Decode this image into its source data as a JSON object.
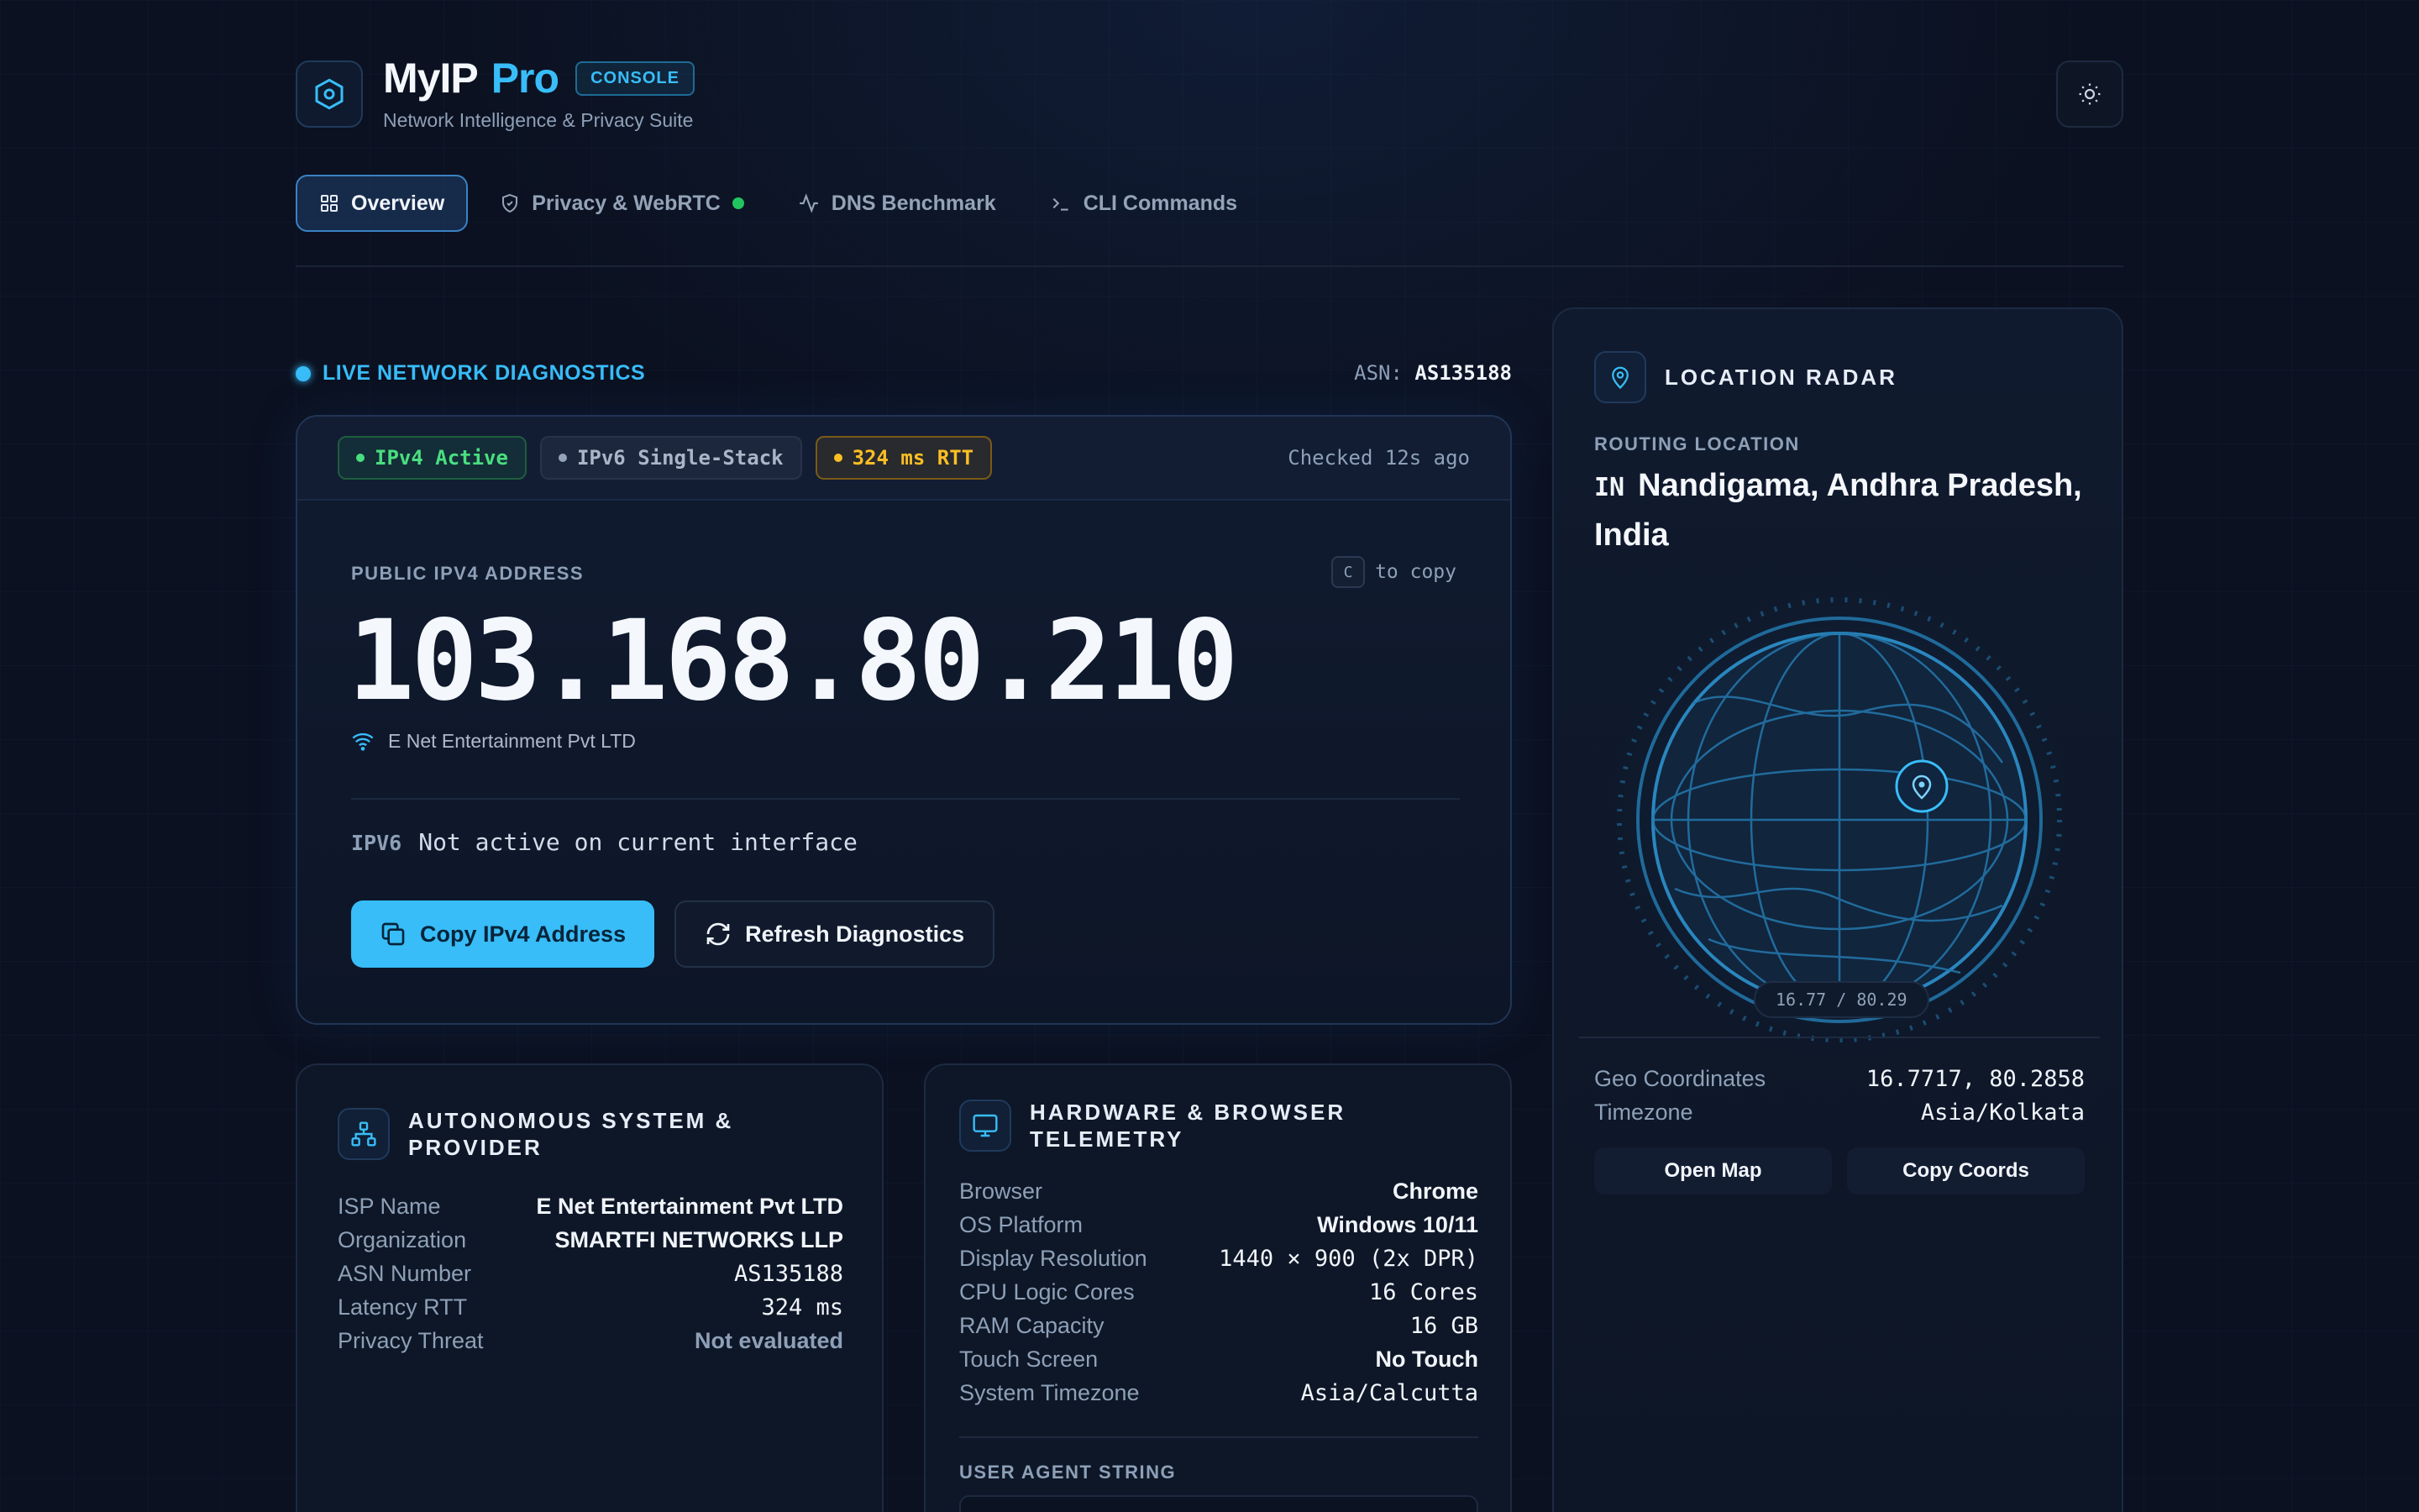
{
  "header": {
    "brand_name": "MyIP",
    "brand_pro": "Pro",
    "badge": "CONSOLE",
    "tagline": "Network Intelligence & Privacy Suite"
  },
  "tabs": [
    {
      "label": "Overview",
      "icon": "grid-icon",
      "active": true
    },
    {
      "label": "Privacy & WebRTC",
      "icon": "shield-icon",
      "status_dot": true
    },
    {
      "label": "DNS Benchmark",
      "icon": "activity-icon"
    },
    {
      "label": "CLI Commands",
      "icon": "terminal-icon"
    }
  ],
  "diagnostics": {
    "live_label": "LIVE NETWORK DIAGNOSTICS",
    "asn_label": "ASN:",
    "asn_value": "AS135188"
  },
  "ip_card": {
    "pills": {
      "ipv4": "IPv4 Active",
      "ipv6": "IPv6 Single-Stack",
      "rtt": "324 ms RTT"
    },
    "checked": "Checked 12s ago",
    "address_label": "PUBLIC IPV4 ADDRESS",
    "copy_key": "C",
    "copy_hint": "to copy",
    "ip": "103.168.80.210",
    "isp": "E Net Entertainment Pvt LTD",
    "ipv6_label": "IPV6",
    "ipv6_value": "Not active on current interface",
    "copy_button": "Copy IPv4 Address",
    "refresh_button": "Refresh Diagnostics"
  },
  "asys_card": {
    "title_line1": "AUTONOMOUS SYSTEM &",
    "title_line2": "PROVIDER",
    "rows": [
      {
        "k": "ISP Name",
        "v": "E Net Entertainment Pvt LTD"
      },
      {
        "k": "Organization",
        "v": "SMARTFI NETWORKS LLP"
      },
      {
        "k": "ASN Number",
        "v": "AS135188"
      },
      {
        "k": "Latency RTT",
        "v": "324 ms"
      },
      {
        "k": "Privacy Threat",
        "v": "Not evaluated"
      }
    ]
  },
  "hw_card": {
    "title_line1": "HARDWARE & BROWSER",
    "title_line2": "TELEMETRY",
    "rows": [
      {
        "k": "Browser",
        "v": "Chrome"
      },
      {
        "k": "OS Platform",
        "v": "Windows 10/11"
      },
      {
        "k": "Display Resolution",
        "v": "1440 × 900 (2x DPR)"
      },
      {
        "k": "CPU Logic Cores",
        "v": "16 Cores"
      },
      {
        "k": "RAM Capacity",
        "v": "16 GB"
      },
      {
        "k": "Touch Screen",
        "v": "No Touch"
      },
      {
        "k": "System Timezone",
        "v": "Asia/Calcutta"
      }
    ],
    "ua_label": "USER AGENT STRING"
  },
  "location": {
    "title": "LOCATION RADAR",
    "routing_label": "ROUTING LOCATION",
    "country_code": "IN",
    "place_line1": "Nandigama, Andhra Pradesh,",
    "place_line2": "India",
    "coord_badge": "16.77 / 80.29",
    "rows": [
      {
        "k": "Geo Coordinates",
        "v": "16.7717, 80.2858"
      },
      {
        "k": "Timezone",
        "v": "Asia/Kolkata"
      }
    ],
    "open_map": "Open Map",
    "copy_coords": "Copy Coords"
  },
  "colors": {
    "accent": "#38bdf8",
    "success": "#4ade80",
    "warning": "#fbbf24",
    "background": "#0b1120"
  }
}
